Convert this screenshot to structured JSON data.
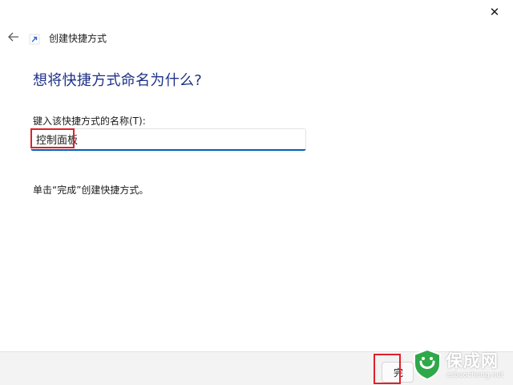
{
  "window": {
    "title": "创建快捷方式",
    "close_glyph": "✕",
    "back_icon": "arrow-left-icon",
    "shortcut_icon": "shortcut-arrow-icon"
  },
  "main": {
    "heading": "想将快捷方式命名为什么?",
    "field_label": "键入该快捷方式的名称(T):",
    "name_value": "控制面板",
    "instruction": "单击“完成”创建快捷方式。"
  },
  "footer": {
    "finish_label": "完"
  },
  "watermark": {
    "name": "保成网",
    "url": "zsbaocheng.net"
  },
  "colors": {
    "heading": "#1e3287",
    "accent": "#005fb8",
    "highlight": "#e0202a",
    "watermark_green": "#2fa84a"
  }
}
